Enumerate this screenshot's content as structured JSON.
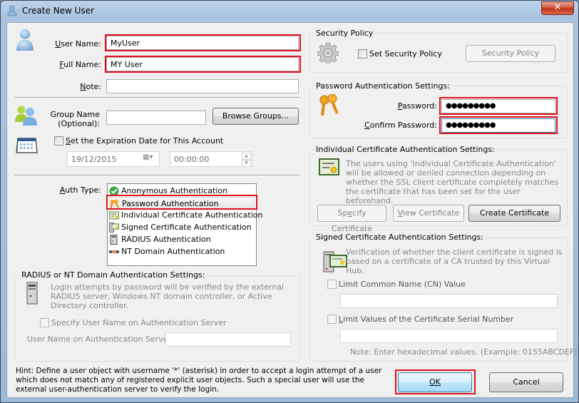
{
  "window": {
    "title": "Create New User",
    "close_label": "✕"
  },
  "user": {
    "user_name_label": "User Name:",
    "user_name_value": "MyUser",
    "full_name_label": "Full Name:",
    "full_name_value": "MY User",
    "note_label": "Note:",
    "note_value": ""
  },
  "group": {
    "label_line1": "Group Name",
    "label_line2": "(Optional):",
    "value": "",
    "browse_button": "Browse Groups..."
  },
  "expiration": {
    "checkbox_label": "Set the Expiration Date for This Account",
    "checked": false,
    "date_value": "19/12/2015",
    "time_value": "00:00:00"
  },
  "auth_type": {
    "label": "Auth Type:",
    "items": [
      {
        "label": "Anonymous Authentication",
        "icon": "check-circle-icon"
      },
      {
        "label": "Password Authentication",
        "icon": "keys-icon"
      },
      {
        "label": "Individual Certificate Authentication",
        "icon": "certificate-icon"
      },
      {
        "label": "Signed Certificate Authentication",
        "icon": "server-certificate-icon"
      },
      {
        "label": "RADIUS Authentication",
        "icon": "server-icon"
      },
      {
        "label": "NT Domain Authentication",
        "icon": "handshake-icon"
      }
    ],
    "selected_index": 1
  },
  "radius": {
    "title": "RADIUS or NT Domain Authentication Settings:",
    "description": "Login attempts by password will be verified by the external RADIUS server, Windows NT domain controller, or Active Directory controller.",
    "specify_checkbox_label": "Specify User Name on Authentication Server",
    "specify_checked": false,
    "server_user_label": "User Name on Authentication Server:",
    "server_user_value": ""
  },
  "security_policy": {
    "title": "Security Policy",
    "checkbox_label": "Set Security Policy",
    "checked": false,
    "button": "Security Policy"
  },
  "password": {
    "title": "Password Authentication Settings:",
    "password_label": "Password:",
    "password_value": "●●●●●●●●●",
    "confirm_label": "Confirm Password:",
    "confirm_value": "●●●●●●●●●"
  },
  "individual_cert": {
    "title": "Individual Certificate Authentication Settings:",
    "description": "The users using 'Individual Certificate Authentication' will be allowed or denied connection depending on whether the SSL client certificate completely matches the certificate that has been set for the user beforehand.",
    "specify_button": "Specify Certificate",
    "view_button": "View Certificate",
    "create_button": "Create Certificate"
  },
  "signed_cert": {
    "title": "Signed Certificate Authentication Settings:",
    "description": "Verification of whether the client certificate is signed is based on a certificate of a CA trusted by this Virtual Hub.",
    "limit_cn_label": "Limit Common Name (CN) Value",
    "limit_cn_checked": false,
    "limit_cn_value": "",
    "limit_serial_label": "Limit Values of the Certificate Serial Number",
    "limit_serial_checked": false,
    "limit_serial_value": "",
    "note": "Note: Enter hexadecimal values. (Example: 0155ABCDEF)"
  },
  "footer": {
    "hint": "Hint: Define a user object with username '*' (asterisk) in order to accept a login attempt of a user which does not match any of registered explicit user objects. Such a special user will use the external user-authentication server to verify the login.",
    "ok_button": "OK",
    "cancel_button": "Cancel"
  },
  "colors": {
    "highlight": "#e0101c",
    "default_button": "#bee6fd"
  }
}
